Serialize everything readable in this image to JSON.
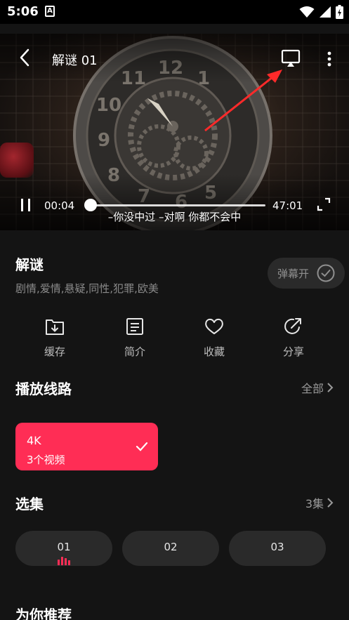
{
  "status_bar": {
    "time": "5:06",
    "notification_icon": "A",
    "icons": [
      "wifi-icon",
      "signal-icon",
      "battery-icon"
    ]
  },
  "player": {
    "title": "解谜 01",
    "current_time": "00:04",
    "total_time": "47:01",
    "progress": 0.0,
    "subtitle": "–你没中过 –对啊 你都不会中",
    "annotation_color": "#ff2a2a"
  },
  "info": {
    "title": "解谜",
    "tags": "剧情,爱情,悬疑,同性,犯罪,欧美",
    "danmaku_label": "弹幕开"
  },
  "actions": [
    {
      "label": "缓存",
      "icon": "download-folder-icon"
    },
    {
      "label": "简介",
      "icon": "document-icon"
    },
    {
      "label": "收藏",
      "icon": "heart-icon"
    },
    {
      "label": "分享",
      "icon": "share-icon"
    }
  ],
  "routes": {
    "title": "播放线路",
    "more_label": "全部",
    "items": [
      {
        "name": "4K",
        "count": "3个视频",
        "selected": true
      }
    ]
  },
  "episodes": {
    "title": "选集",
    "count_label": "3集",
    "items": [
      {
        "label": "01",
        "playing": true
      },
      {
        "label": "02",
        "playing": false
      },
      {
        "label": "03",
        "playing": false
      }
    ]
  },
  "recommend": {
    "title": "为你推荐"
  },
  "colors": {
    "accent": "#ff2d55",
    "background": "#141414",
    "pill": "#2a2a2a"
  }
}
